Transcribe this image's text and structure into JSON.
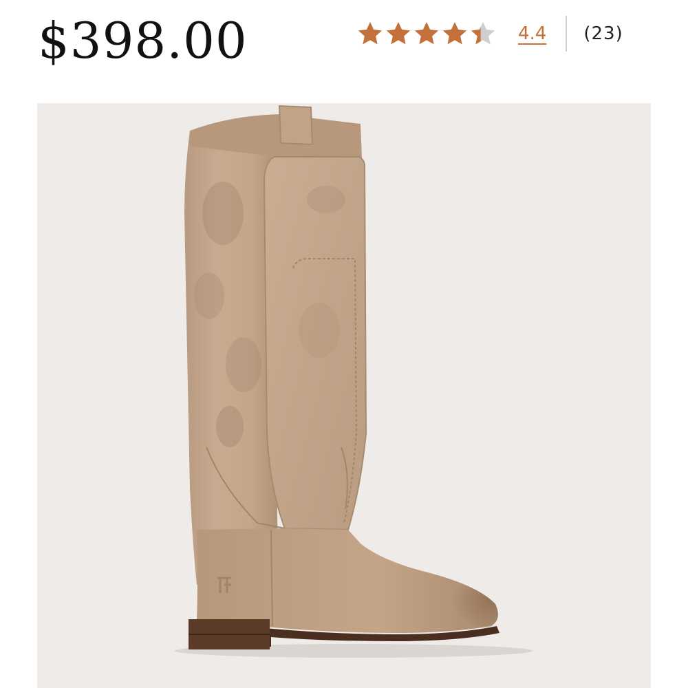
{
  "product": {
    "price": "$398.00",
    "image_alt": "Tall tan leather riding boot"
  },
  "rating": {
    "value_label": "4.4",
    "review_count_label": "(23)",
    "score": 4.4,
    "max": 5,
    "star_color": "#c3703a",
    "empty_star_color": "#cfcfcf",
    "star_icons": [
      "star-full-icon",
      "star-full-icon",
      "star-full-icon",
      "star-full-icon",
      "star-partial-icon"
    ]
  },
  "colors": {
    "accent": "#c3703a",
    "image_background": "#eeebe8",
    "price_text": "#111111"
  }
}
